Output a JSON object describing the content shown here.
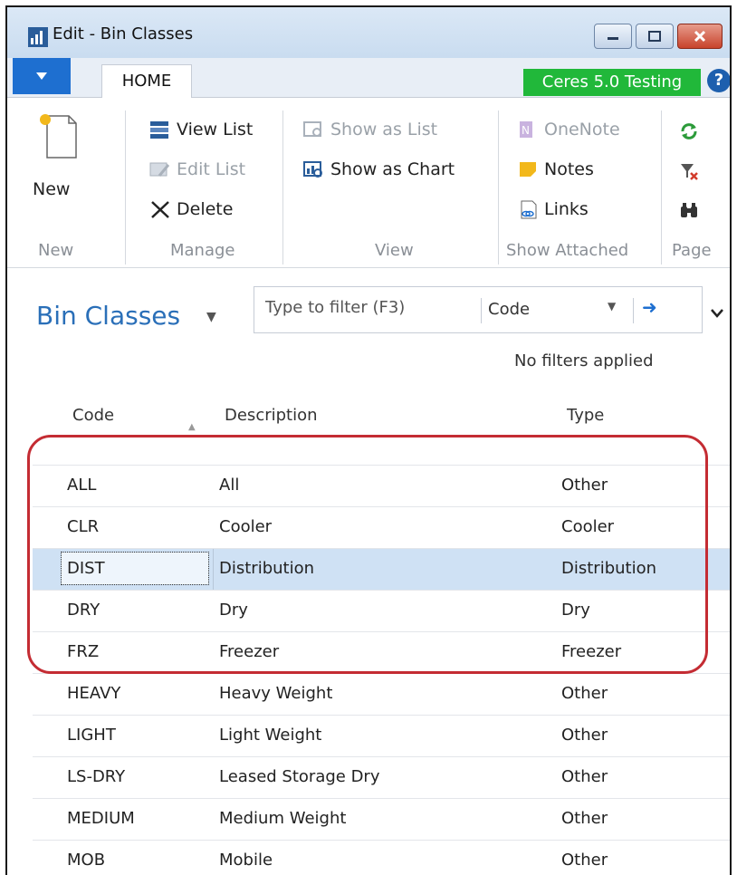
{
  "window": {
    "title": "Edit - Bin Classes"
  },
  "ribbon": {
    "tab": "HOME",
    "company": "Ceres 5.0 Testing",
    "help": "?",
    "groups": {
      "new": {
        "label": "New",
        "new_button": "New"
      },
      "manage": {
        "label": "Manage",
        "view_list": "View List",
        "edit_list": "Edit List",
        "delete": "Delete"
      },
      "view": {
        "label": "View",
        "show_as_list": "Show as List",
        "show_as_chart": "Show as Chart"
      },
      "show_attached": {
        "label": "Show Attached",
        "onenote": "OneNote",
        "notes": "Notes",
        "links": "Links"
      },
      "page": {
        "label": "Page"
      }
    }
  },
  "page": {
    "title": "Bin Classes",
    "filter": {
      "placeholder": "Type to filter (F3)",
      "field": "Code"
    },
    "filters_status": "No filters applied"
  },
  "table": {
    "headers": {
      "code": "Code",
      "description": "Description",
      "type": "Type"
    },
    "rows": [
      {
        "code": "ALL",
        "description": "All",
        "type": "Other"
      },
      {
        "code": "CLR",
        "description": "Cooler",
        "type": "Cooler"
      },
      {
        "code": "DIST",
        "description": "Distribution",
        "type": "Distribution"
      },
      {
        "code": "DRY",
        "description": "Dry",
        "type": "Dry"
      },
      {
        "code": "FRZ",
        "description": "Freezer",
        "type": "Freezer"
      },
      {
        "code": "HEAVY",
        "description": "Heavy Weight",
        "type": "Other"
      },
      {
        "code": "LIGHT",
        "description": "Light Weight",
        "type": "Other"
      },
      {
        "code": "LS-DRY",
        "description": "Leased Storage Dry",
        "type": "Other"
      },
      {
        "code": "MEDIUM",
        "description": "Medium Weight",
        "type": "Other"
      },
      {
        "code": "MOB",
        "description": "Mobile",
        "type": "Other"
      }
    ],
    "selected_index": 2
  },
  "colors": {
    "accent": "#1e6fd0",
    "title_blue": "#2a6fb8",
    "badge_green": "#21b83a",
    "highlight_red": "#c42c33",
    "selected_row": "#cfe1f4"
  }
}
